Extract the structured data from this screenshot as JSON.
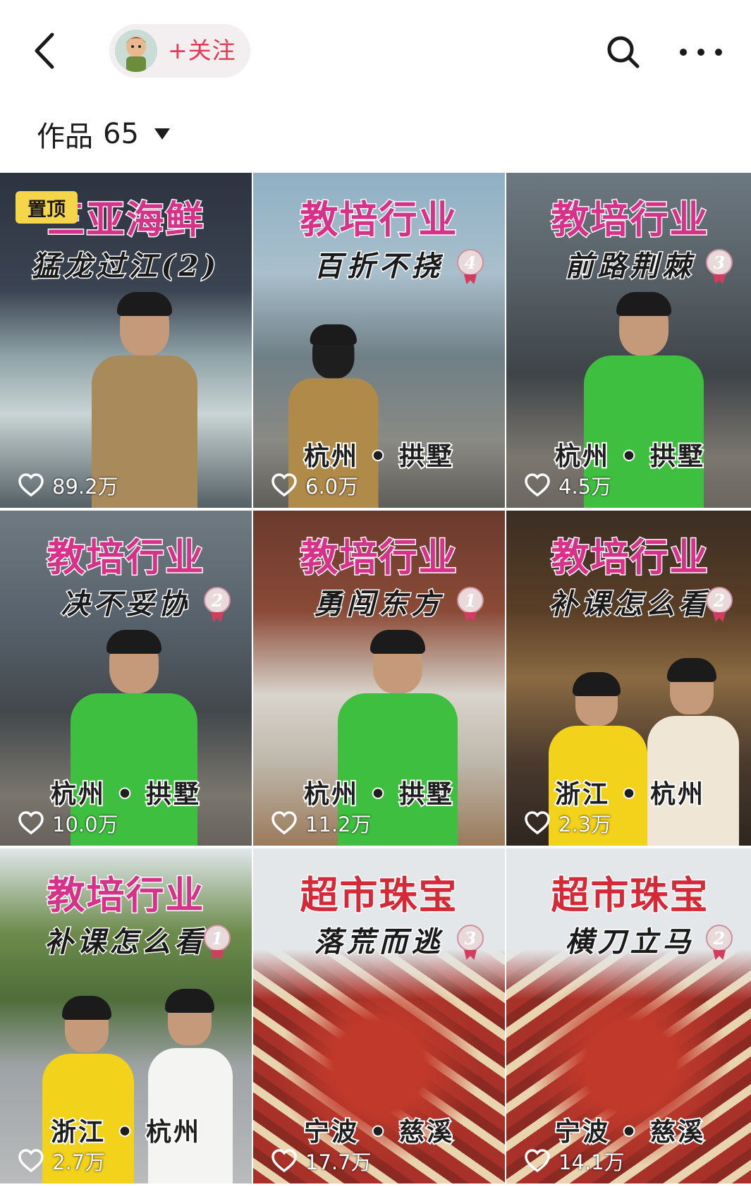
{
  "header": {
    "follow_label": "+关注"
  },
  "works": {
    "label": "作品",
    "count": "65"
  },
  "grid": [
    {
      "pinned": "置顶",
      "title": "三亚海鲜",
      "subtitle": "猛龙过江(2)",
      "rank": "",
      "location": "",
      "likes": "89.2万"
    },
    {
      "pinned": "",
      "title": "教培行业",
      "subtitle": "百折不挠",
      "rank": "4",
      "location": "杭州 • 拱墅",
      "likes": "6.0万"
    },
    {
      "pinned": "",
      "title": "教培行业",
      "subtitle": "前路荆棘",
      "rank": "3",
      "location": "杭州 • 拱墅",
      "likes": "4.5万"
    },
    {
      "pinned": "",
      "title": "教培行业",
      "subtitle": "决不妥协",
      "rank": "2",
      "location": "杭州 • 拱墅",
      "likes": "10.0万"
    },
    {
      "pinned": "",
      "title": "教培行业",
      "subtitle": "勇闯东方",
      "rank": "1",
      "location": "杭州 • 拱墅",
      "likes": "11.2万"
    },
    {
      "pinned": "",
      "title": "教培行业",
      "subtitle": "补课怎么看",
      "rank": "2",
      "location": "浙江 • 杭州",
      "likes": "2.3万"
    },
    {
      "pinned": "",
      "title": "教培行业",
      "subtitle": "补课怎么看",
      "rank": "1",
      "location": "浙江 • 杭州",
      "likes": "2.7万"
    },
    {
      "pinned": "",
      "title": "超市珠宝",
      "subtitle": "落荒而逃",
      "rank": "3",
      "location": "宁波 • 慈溪",
      "likes": "17.7万"
    },
    {
      "pinned": "",
      "title": "超市珠宝",
      "subtitle": "横刀立马",
      "rank": "2",
      "location": "宁波 • 慈溪",
      "likes": "14.1万"
    }
  ],
  "icons": {
    "back": "chevron-left-icon",
    "search": "search-icon",
    "more": "more-dots-icon",
    "like": "heart-outline-icon",
    "dropdown": "caret-down-icon"
  },
  "colors": {
    "follow_text": "#e53a55",
    "title_pink": "#d6328a",
    "title_red": "#d42a37",
    "pinned_badge": "#f5d54a"
  }
}
